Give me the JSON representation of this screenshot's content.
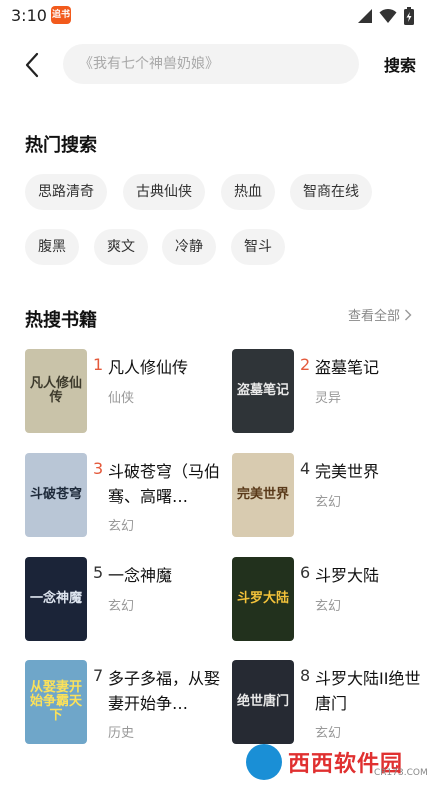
{
  "status_bar": {
    "time": "3:10",
    "app_badge": "追书"
  },
  "header": {
    "search_placeholder": "《我有七个神兽奶娘》",
    "search_button": "搜索"
  },
  "hot_search": {
    "title": "热门搜索",
    "tags": [
      "思路清奇",
      "古典仙侠",
      "热血",
      "智商在线",
      "腹黑",
      "爽文",
      "冷静",
      "智斗"
    ]
  },
  "hot_books": {
    "title": "热搜书籍",
    "view_all": "查看全部",
    "books": [
      {
        "rank": "1",
        "title": "凡人修仙传",
        "category": "仙侠",
        "cover_text": "凡人修仙传",
        "cover_bg": "#c9c3a9",
        "cover_fg": "#3d3a2c"
      },
      {
        "rank": "2",
        "title": "盗墓笔记",
        "category": "灵异",
        "cover_text": "盗墓笔记",
        "cover_bg": "#2f3438",
        "cover_fg": "#e8e8e8"
      },
      {
        "rank": "3",
        "title": "斗破苍穹（马伯骞、高曙…",
        "category": "玄幻",
        "cover_text": "斗破苍穹",
        "cover_bg": "#b9c6d6",
        "cover_fg": "#1e2a3a"
      },
      {
        "rank": "4",
        "title": "完美世界",
        "category": "玄幻",
        "cover_text": "完美世界",
        "cover_bg": "#d8cbb0",
        "cover_fg": "#5a3a1a"
      },
      {
        "rank": "5",
        "title": "一念神魔",
        "category": "玄幻",
        "cover_text": "一念神魔",
        "cover_bg": "#1b2438",
        "cover_fg": "#dfe6f0"
      },
      {
        "rank": "6",
        "title": "斗罗大陆",
        "category": "玄幻",
        "cover_text": "斗罗大陆",
        "cover_bg": "#22311d",
        "cover_fg": "#f3c23a"
      },
      {
        "rank": "7",
        "title": "多子多福，从娶妻开始争…",
        "category": "历史",
        "cover_text": "从娶妻开始争霸天下",
        "cover_bg": "#6fa6c9",
        "cover_fg": "#fbe15a"
      },
      {
        "rank": "8",
        "title": "斗罗大陆II绝世唐门",
        "category": "玄幻",
        "cover_text": "绝世唐门",
        "cover_bg": "#262a33",
        "cover_fg": "#e8e8e8"
      }
    ]
  },
  "watermark": {
    "text": "西西软件园",
    "sub": "CR173.COM"
  },
  "colors": {
    "accent": "#e4593b",
    "chip_bg": "#f3f3f3"
  }
}
